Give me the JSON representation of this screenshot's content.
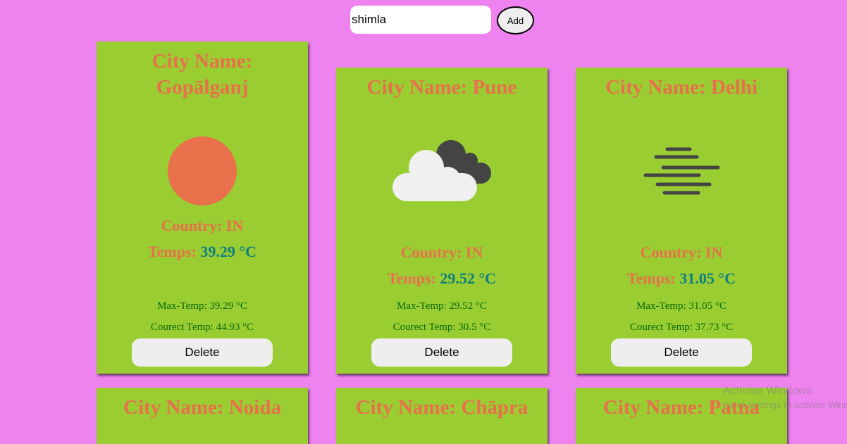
{
  "search": {
    "value": "shimla",
    "add_label": "Add"
  },
  "labels": {
    "country_prefix": "Country:",
    "temps_prefix": "Temps:",
    "delete_label": "Delete"
  },
  "cards": [
    {
      "title": "City Name:\nGopālganj",
      "icon": "sun-icon",
      "country": "Country: IN",
      "temp": "39.29 °C",
      "max_temp": "Max-Temp: 39.29 °C",
      "current_temp": "Courect Temp: 44.93 °C"
    },
    {
      "title": "City Name: Pune",
      "icon": "clouds-icon",
      "country": "Country: IN",
      "temp": "29.52 °C",
      "max_temp": "Max-Temp: 29.52 °C",
      "current_temp": "Courect Temp: 30.5 °C"
    },
    {
      "title": "City Name: Delhi",
      "icon": "haze-icon",
      "country": "Country: IN",
      "temp": "31.05 °C",
      "max_temp": "Max-Temp: 31.05 °C",
      "current_temp": "Courect Temp: 37.73 °C"
    },
    {
      "title": "City Name: Noida"
    },
    {
      "title": "City Name: Chāpra"
    },
    {
      "title": "City Name: Patna"
    }
  ],
  "watermark": {
    "line1": "Activate Windows",
    "line2": "Go to Settings to activate Windows."
  },
  "colors": {
    "background": "#ee82ee",
    "card": "#9acd32",
    "accent": "#e8704a",
    "temp": "#0f7f7f"
  }
}
